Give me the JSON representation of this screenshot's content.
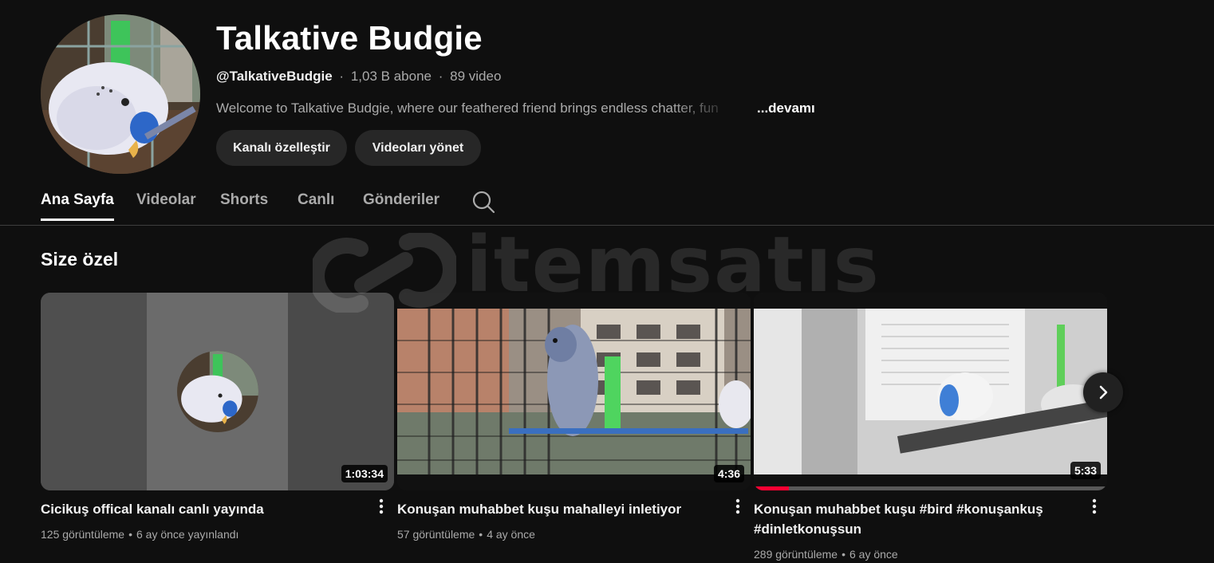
{
  "channel": {
    "name": "Talkative Budgie",
    "handle": "@TalkativeBudgie",
    "subscribers": "1,03 B abone",
    "video_count": "89 video",
    "separator": "·",
    "description": "Welcome to Talkative Budgie, where our feathered friend brings endless chatter, fun",
    "more_label": "...devamı",
    "customize_button": "Kanalı özelleştir",
    "manage_button": "Videoları yönet"
  },
  "tabs": [
    {
      "label": "Ana Sayfa",
      "active": true
    },
    {
      "label": "Videolar",
      "active": false
    },
    {
      "label": "Shorts",
      "active": false
    },
    {
      "label": "Canlı",
      "active": false
    },
    {
      "label": "Gönderiler",
      "active": false
    }
  ],
  "icons": {
    "search": "search-icon",
    "kebab": "more-vert-icon",
    "next": "chevron-right-icon"
  },
  "section": {
    "title": "Size özel"
  },
  "videos": [
    {
      "title": "Cicikuş offical kanalı canlı yayında",
      "views": "125 görüntüleme",
      "age": "6 ay önce yayınlandı",
      "duration": "1:03:34"
    },
    {
      "title": "Konuşan muhabbet kuşu mahalleyi inletiyor",
      "views": "57 görüntüleme",
      "age": "4 ay önce",
      "duration": "4:36"
    },
    {
      "title": "Konuşan muhabbet kuşu #bird #konuşankuş #dinletkonuşsun",
      "views": "289 görüntüleme",
      "age": "6 ay önce",
      "duration": "5:33",
      "watch_progress": 0.1
    }
  ],
  "meta_dot": "•",
  "watermark": "itemsatıs",
  "colors": {
    "background": "#0f0f0f",
    "progress": "#ff0033",
    "button_bg": "#272727"
  }
}
